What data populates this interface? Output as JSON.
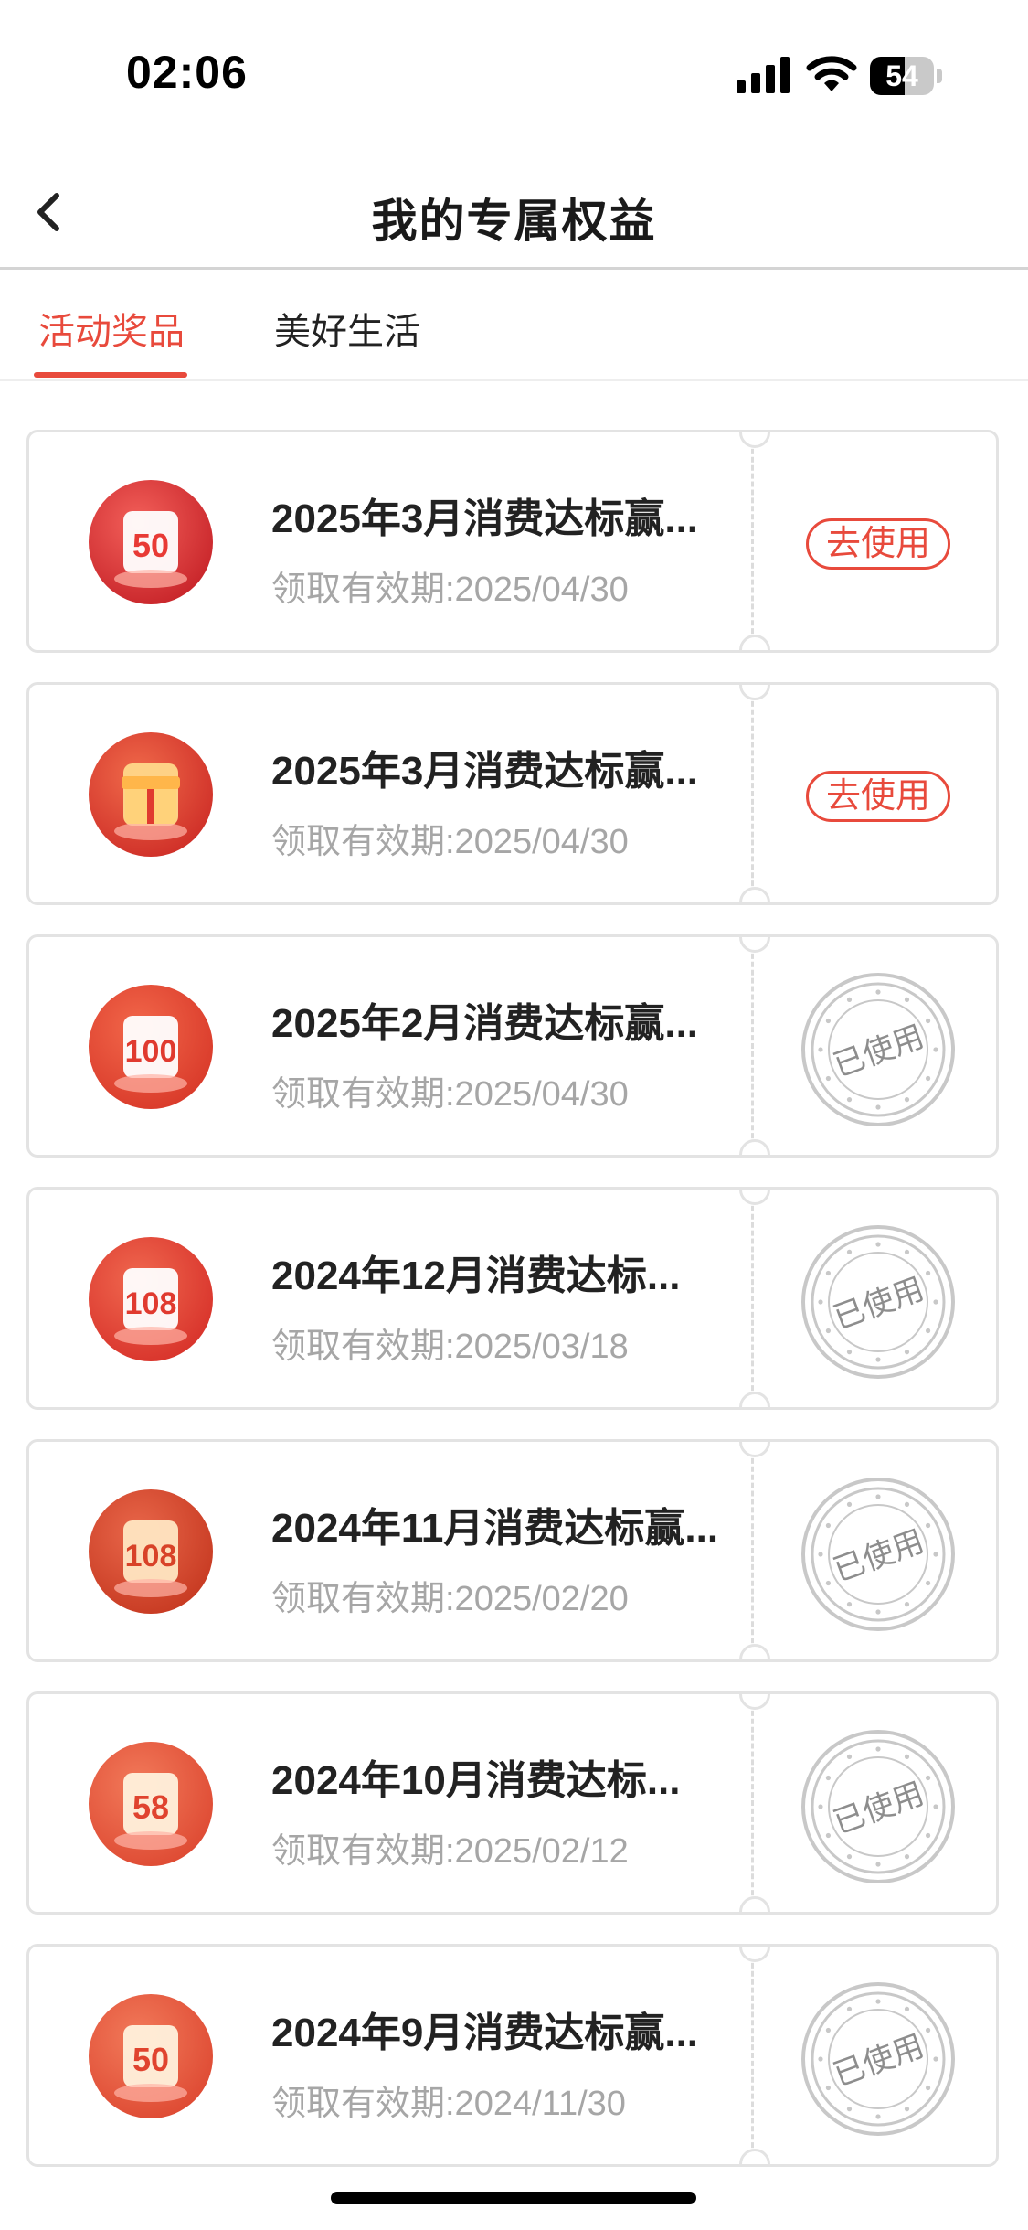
{
  "status_bar": {
    "time": "02:06",
    "battery": "54",
    "battery_level": 0.54
  },
  "nav": {
    "title": "我的专属权益"
  },
  "tabs": [
    {
      "label": "活动奖品",
      "active": true
    },
    {
      "label": "美好生活",
      "active": false
    }
  ],
  "rewards": [
    {
      "title": "2025年3月消费达标赢...",
      "validity": "领取有效期:2025/04/30",
      "status": "available",
      "action_label": "去使用",
      "icon": "coupon-50-icon",
      "icon_value": "50"
    },
    {
      "title": "2025年3月消费达标赢...",
      "validity": "领取有效期:2025/04/30",
      "status": "available",
      "action_label": "去使用",
      "icon": "gift-box-icon",
      "icon_value": ""
    },
    {
      "title": "2025年2月消费达标赢...",
      "validity": "领取有效期:2025/04/30",
      "status": "used",
      "action_label": "已使用",
      "icon": "coupon-100-icon",
      "icon_value": "100"
    },
    {
      "title": "2024年12月消费达标...",
      "validity": "领取有效期:2025/03/18",
      "status": "used",
      "action_label": "已使用",
      "icon": "coupon-108-icon",
      "icon_value": "108"
    },
    {
      "title": "2024年11月消费达标赢...",
      "validity": "领取有效期:2025/02/20",
      "status": "used",
      "action_label": "已使用",
      "icon": "coupon-108-scroll-icon",
      "icon_value": "108"
    },
    {
      "title": "2024年10月消费达标...",
      "validity": "领取有效期:2025/02/12",
      "status": "used",
      "action_label": "已使用",
      "icon": "coupon-58-icon",
      "icon_value": "58"
    },
    {
      "title": "2024年9月消费达标赢...",
      "validity": "领取有效期:2024/11/30",
      "status": "used",
      "action_label": "已使用",
      "icon": "coupon-50-envelope-icon",
      "icon_value": "50"
    }
  ],
  "colors": {
    "accent": "#e84a3c",
    "muted": "#a6a6a6",
    "stamp": "#c8c8c8"
  }
}
